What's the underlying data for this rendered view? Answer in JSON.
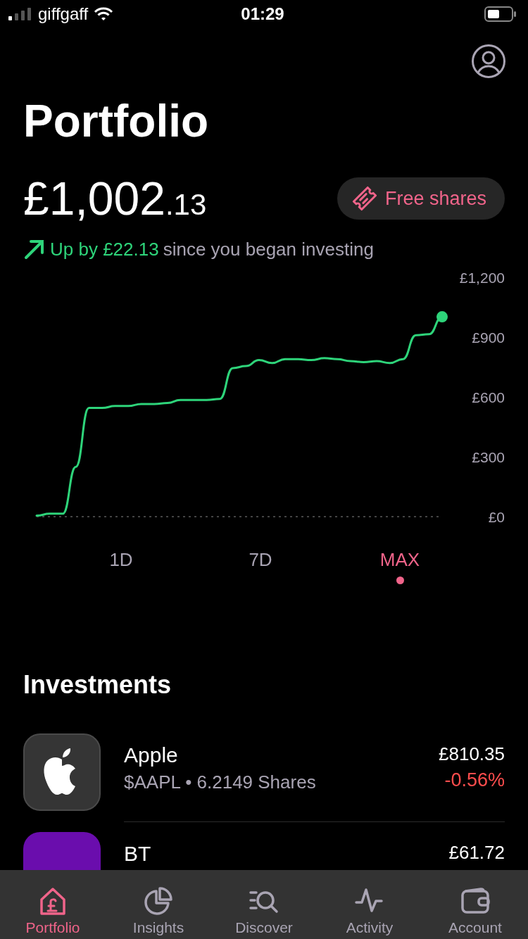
{
  "status_bar": {
    "carrier": "giffgaff",
    "time": "01:29"
  },
  "header": {
    "title": "Portfolio"
  },
  "balance": {
    "amount_main": "£1,002",
    "amount_decimals": ".13"
  },
  "free_shares_button": {
    "label": "Free shares"
  },
  "change": {
    "label": "Up by £22.13",
    "note": "since you began investing"
  },
  "chart": {
    "chart_data": {
      "type": "line",
      "ylim": [
        0,
        1200
      ],
      "yticks": [
        {
          "value": 1200,
          "label": "£1,200"
        },
        {
          "value": 900,
          "label": "£900"
        },
        {
          "value": 600,
          "label": "£600"
        },
        {
          "value": 300,
          "label": "£300"
        },
        {
          "value": 0,
          "label": "£0"
        }
      ],
      "series": [
        {
          "color": "#2ed47a",
          "values": [
            5,
            15,
            15,
            250,
            545,
            545,
            555,
            555,
            565,
            565,
            570,
            585,
            585,
            585,
            590,
            745,
            755,
            785,
            770,
            790,
            790,
            785,
            795,
            790,
            780,
            775,
            780,
            770,
            790,
            910,
            915,
            1002
          ]
        }
      ]
    }
  },
  "ranges": [
    {
      "label": "1D",
      "selected": false
    },
    {
      "label": "7D",
      "selected": false
    },
    {
      "label": "MAX",
      "selected": true
    }
  ],
  "investments": {
    "title": "Investments",
    "items": [
      {
        "kind": "apple",
        "name": "Apple",
        "detail": "$AAPL • 6.2149 Shares",
        "value": "£810.35",
        "change": "-0.56%"
      },
      {
        "kind": "bt",
        "name": "BT",
        "value": "£61.72"
      }
    ]
  },
  "tab_bar": [
    {
      "kind": "portfolio",
      "label": "Portfolio",
      "selected": true
    },
    {
      "kind": "insights",
      "label": "Insights",
      "selected": false
    },
    {
      "kind": "discover",
      "label": "Discover",
      "selected": false
    },
    {
      "kind": "activity",
      "label": "Activity",
      "selected": false
    },
    {
      "kind": "account",
      "label": "Account",
      "selected": false
    }
  ]
}
